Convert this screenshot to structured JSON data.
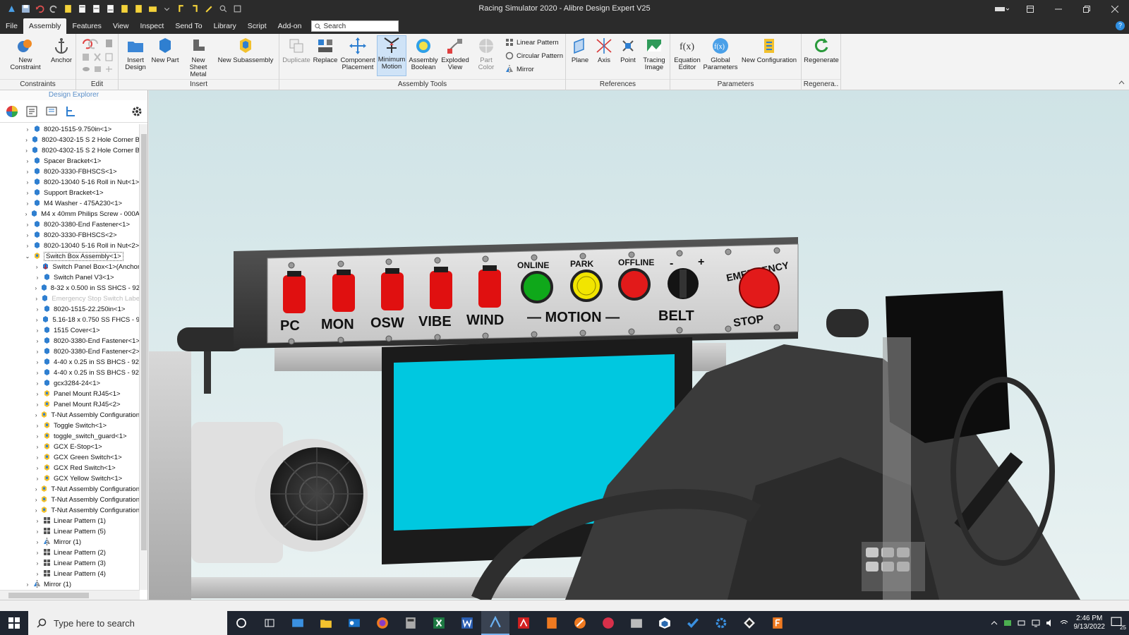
{
  "window": {
    "title": "Racing Simulator 2020 - Alibre Design Expert V25"
  },
  "menu": {
    "items": [
      "File",
      "Assembly",
      "Features",
      "View",
      "Inspect",
      "Send To",
      "Library",
      "Script",
      "Add-on"
    ],
    "search_placeholder": "Search"
  },
  "ribbon": {
    "groups": {
      "constraints": "Constraints",
      "edit": "Edit",
      "insert": "Insert",
      "assembly_tools": "Assembly Tools",
      "references": "References",
      "parameters": "Parameters",
      "regenerate": "Regenera.."
    },
    "buttons": {
      "new_constraint": "New Constraint",
      "anchor": "Anchor",
      "insert_design_1": "Insert",
      "insert_design_2": "Design",
      "new_part": "New Part",
      "new_sheet_metal_1": "New Sheet",
      "new_sheet_metal_2": "Metal",
      "new_subassembly": "New Subassembly",
      "duplicate": "Duplicate",
      "replace": "Replace",
      "component_placement_1": "Component",
      "component_placement_2": "Placement",
      "minimum_motion_1": "Minimum",
      "minimum_motion_2": "Motion",
      "assembly_boolean_1": "Assembly",
      "assembly_boolean_2": "Boolean",
      "exploded_view_1": "Exploded",
      "exploded_view_2": "View",
      "part_color": "Part Color",
      "linear_pattern": "Linear Pattern",
      "circular_pattern": "Circular Pattern",
      "mirror": "Mirror",
      "plane": "Plane",
      "axis": "Axis",
      "point": "Point",
      "tracing_image_1": "Tracing",
      "tracing_image_2": "Image",
      "equation_editor_1": "Equation",
      "equation_editor_2": "Editor",
      "global_parameters_1": "Global",
      "global_parameters_2": "Parameters",
      "new_configuration": "New Configuration",
      "regenerate": "Regenerate"
    }
  },
  "explorer": {
    "title": "Design Explorer",
    "tree": [
      {
        "label": "8020-1515-9.750in<1>",
        "level": 1,
        "icon": "part"
      },
      {
        "label": "8020-4302-15 S 2 Hole Corner B",
        "level": 1,
        "icon": "part"
      },
      {
        "label": "8020-4302-15 S 2 Hole Corner B",
        "level": 1,
        "icon": "part"
      },
      {
        "label": "Spacer Bracket<1>",
        "level": 1,
        "icon": "part"
      },
      {
        "label": "8020-3330-FBHSCS<1>",
        "level": 1,
        "icon": "part"
      },
      {
        "label": "8020-13040 5-16 Roll in Nut<1>",
        "level": 1,
        "icon": "part"
      },
      {
        "label": "Support Bracket<1>",
        "level": 1,
        "icon": "part"
      },
      {
        "label": "M4 Washer - 475A230<1>",
        "level": 1,
        "icon": "part"
      },
      {
        "label": "M4 x 40mm Philips Screw - 000A",
        "level": 1,
        "icon": "part"
      },
      {
        "label": "8020-3380-End Fastener<1>",
        "level": 1,
        "icon": "part"
      },
      {
        "label": "8020-3330-FBHSCS<2>",
        "level": 1,
        "icon": "part"
      },
      {
        "label": "8020-13040 5-16 Roll in Nut<2>",
        "level": 1,
        "icon": "part"
      },
      {
        "label": "Switch Box Assembly<1>",
        "level": 1,
        "icon": "asm",
        "expanded": true,
        "selected": true
      },
      {
        "label": "Switch Panel Box<1>(Anchor",
        "level": 2,
        "icon": "anchor"
      },
      {
        "label": "Switch Panel V3<1>",
        "level": 2,
        "icon": "part"
      },
      {
        "label": "8-32 x 0.500 in SS SHCS - 92",
        "level": 2,
        "icon": "part"
      },
      {
        "label": "Emergency Stop Switch Labe",
        "level": 2,
        "icon": "part",
        "dim": true
      },
      {
        "label": "8020-1515-22.250in<1>",
        "level": 2,
        "icon": "part"
      },
      {
        "label": "5.16-18 x 0.750 SS FHCS - 9",
        "level": 2,
        "icon": "part"
      },
      {
        "label": "1515 Cover<1>",
        "level": 2,
        "icon": "part"
      },
      {
        "label": "8020-3380-End Fastener<1>",
        "level": 2,
        "icon": "part"
      },
      {
        "label": "8020-3380-End Fastener<2>",
        "level": 2,
        "icon": "part"
      },
      {
        "label": "4-40 x 0.25 in SS BHCS - 92",
        "level": 2,
        "icon": "part"
      },
      {
        "label": "4-40 x 0.25 in SS BHCS - 92",
        "level": 2,
        "icon": "part"
      },
      {
        "label": "gcx3284-24<1>",
        "level": 2,
        "icon": "part"
      },
      {
        "label": "Panel Mount RJ45<1>",
        "level": 2,
        "icon": "asm"
      },
      {
        "label": "Panel Mount RJ45<2>",
        "level": 2,
        "icon": "asm"
      },
      {
        "label": "T-Nut Assembly Configuration",
        "level": 2,
        "icon": "asm"
      },
      {
        "label": "Toggle Switch<1>",
        "level": 2,
        "icon": "asm"
      },
      {
        "label": "toggle_switch_guard<1>",
        "level": 2,
        "icon": "asm"
      },
      {
        "label": "GCX E-Stop<1>",
        "level": 2,
        "icon": "asm"
      },
      {
        "label": "GCX Green Switch<1>",
        "level": 2,
        "icon": "asm"
      },
      {
        "label": "GCX Red Switch<1>",
        "level": 2,
        "icon": "asm"
      },
      {
        "label": "GCX Yellow Switch<1>",
        "level": 2,
        "icon": "asm"
      },
      {
        "label": "T-Nut Assembly Configuration",
        "level": 2,
        "icon": "asm"
      },
      {
        "label": "T-Nut Assembly Configuration",
        "level": 2,
        "icon": "asm"
      },
      {
        "label": "T-Nut Assembly Configuration",
        "level": 2,
        "icon": "asm"
      },
      {
        "label": "Linear Pattern (1)",
        "level": 2,
        "icon": "pattern"
      },
      {
        "label": "Linear Pattern (5)",
        "level": 2,
        "icon": "pattern"
      },
      {
        "label": "Mirror (1)",
        "level": 2,
        "icon": "mirror"
      },
      {
        "label": "Linear Pattern (2)",
        "level": 2,
        "icon": "pattern"
      },
      {
        "label": "Linear Pattern (3)",
        "level": 2,
        "icon": "pattern"
      },
      {
        "label": "Linear Pattern (4)",
        "level": 2,
        "icon": "pattern"
      },
      {
        "label": "Mirror (1)",
        "level": 1,
        "icon": "mirror"
      }
    ]
  },
  "model": {
    "switch_labels": [
      "PC",
      "MON",
      "OSW",
      "VIBE",
      "WIND"
    ],
    "lamp_labels": [
      "ONLINE",
      "PARK",
      "OFFLINE"
    ],
    "motion_label": "— MOTION —",
    "belt_label": "BELT",
    "belt_minus": "-",
    "belt_plus": "+",
    "estop_top": "EMERGENCY",
    "estop_bottom": "STOP"
  },
  "taskbar": {
    "search_placeholder": "Type here to search",
    "time": "2:46 PM",
    "date": "9/13/2022",
    "notifications": "25"
  },
  "colors": {
    "switch_red": "#e01010",
    "lamp_green": "#0fa81a",
    "lamp_yellow": "#f2e500",
    "lamp_red": "#e21a1a",
    "screen": "#00c8e0",
    "frame": "#2b2b2b"
  }
}
